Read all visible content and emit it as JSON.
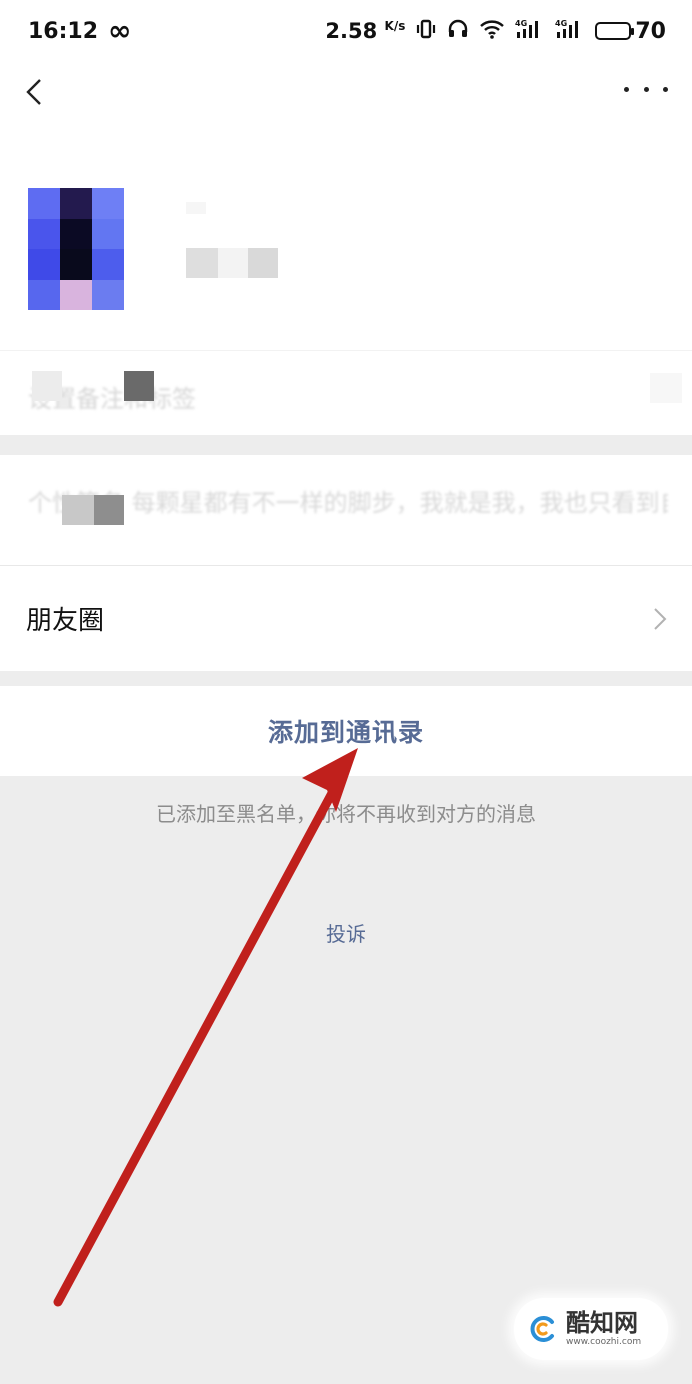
{
  "status_bar": {
    "time": "16:12",
    "infinity": "∞",
    "net_speed": "2.58",
    "net_speed_unit": "K/s",
    "battery_level": "70"
  },
  "navbar": {
    "back_icon": "chevron-left-icon",
    "more_icon": "ellipsis-icon"
  },
  "profile": {
    "remark_tag_text": "设置备注和标签"
  },
  "signature_text": "个性签名   每颗星都有不一样的脚步，我就是我，我也只看到自",
  "moments_label": "朋友圈",
  "add_to_contacts_label": "添加到通讯录",
  "blacklist_note": "已添加至黑名单，你将不再收到对方的消息",
  "complain_label": "投诉",
  "watermark": {
    "title": "酷知网",
    "url": "www.coozhi.com"
  },
  "colors": {
    "link_blue": "#576b95",
    "arrow_red": "#c0201c",
    "background_gray": "#ededed"
  }
}
